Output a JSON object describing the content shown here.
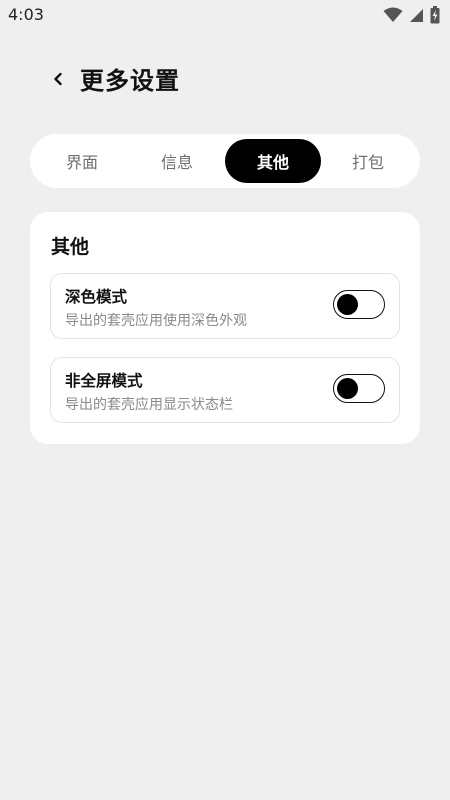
{
  "status_bar": {
    "time": "4:03",
    "icons": [
      "wifi-icon",
      "signal-icon",
      "battery-icon"
    ]
  },
  "header": {
    "back_icon": "chevron-left-icon",
    "title": "更多设置"
  },
  "tabs": [
    {
      "label": "界面",
      "active": false
    },
    {
      "label": "信息",
      "active": false
    },
    {
      "label": "其他",
      "active": true
    },
    {
      "label": "打包",
      "active": false
    }
  ],
  "section": {
    "title": "其他",
    "settings": [
      {
        "label": "深色模式",
        "description": "导出的套壳应用使用深色外观",
        "enabled": false
      },
      {
        "label": "非全屏模式",
        "description": "导出的套壳应用显示状态栏",
        "enabled": false
      }
    ]
  },
  "colors": {
    "background": "#efefef",
    "surface": "#ffffff",
    "accent": "#000000",
    "muted_text": "#8a8a8a"
  }
}
